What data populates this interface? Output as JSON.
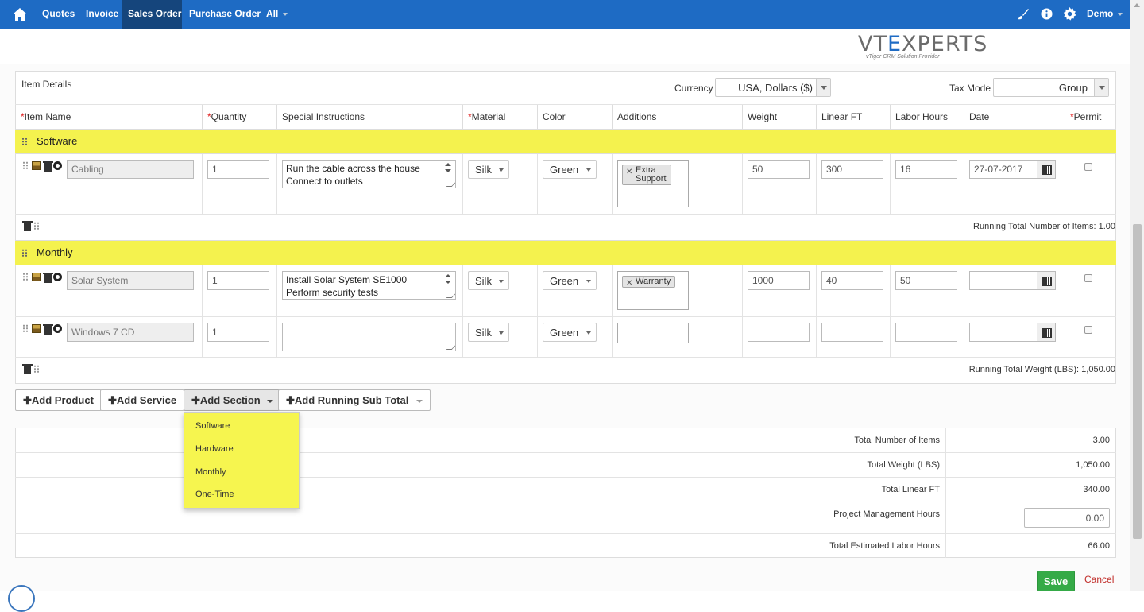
{
  "nav": {
    "items": [
      "Quotes",
      "Invoice",
      "Sales Order",
      "Purchase Order",
      "All"
    ],
    "user": "Demo"
  },
  "logo": {
    "text_pre": "VT",
    "text_x": "E",
    "text_post": "XPERTS",
    "tagline": "vTiger CRM Solution Provider"
  },
  "item_details": {
    "title": "Item Details",
    "currency_label": "Currency",
    "currency_value": "USA, Dollars ($)",
    "tax_mode_label": "Tax Mode",
    "tax_mode_value": "Group"
  },
  "columns": [
    "Item Name",
    "Quantity",
    "Special Instructions",
    "Material",
    "Color",
    "Additions",
    "Weight",
    "Linear FT",
    "Labor Hours",
    "Date",
    "Permit"
  ],
  "required_mark": "*",
  "sections": [
    {
      "name": "Software",
      "rows": [
        {
          "item": "Cabling",
          "qty": "1",
          "instr1": "Run the cable across the house",
          "instr2": "Connect to outlets",
          "material": "Silk",
          "color": "Green",
          "addition1": "Extra",
          "addition2": "Support",
          "weight": "50",
          "linear": "300",
          "labor": "16",
          "date": "27-07-2017"
        }
      ],
      "running_total": "Running Total Number of Items: 1.00"
    },
    {
      "name": "Monthly",
      "rows": [
        {
          "item": "Solar System",
          "qty": "1",
          "instr1": "Install Solar System SE1000",
          "instr2": "Perform security tests",
          "material": "Silk",
          "color": "Green",
          "addition1": "Warranty",
          "weight": "1000",
          "linear": "40",
          "labor": "50",
          "date": ""
        },
        {
          "item": "Windows 7 CD",
          "qty": "1",
          "instr1": "",
          "instr2": "",
          "material": "Silk",
          "color": "Green",
          "weight": "",
          "linear": "",
          "labor": "",
          "date": ""
        }
      ],
      "running_total": "Running Total Weight (LBS): 1,050.00"
    }
  ],
  "buttons": {
    "add_product": "Add Product",
    "add_service": "Add Service",
    "add_section": "Add Section",
    "add_running": "Add Running Sub Total"
  },
  "section_menu": [
    "Software",
    "Hardware",
    "Monthly",
    "One-Time"
  ],
  "totals": [
    {
      "label": "Total Number of Items",
      "value": "3.00"
    },
    {
      "label": "Total Weight (LBS)",
      "value": "1,050.00"
    },
    {
      "label": "Total Linear FT",
      "value": "340.00"
    },
    {
      "label": "Project Management Hours",
      "value": "0.00"
    },
    {
      "label": "Total Estimated Labor Hours",
      "value": "66.00"
    }
  ],
  "actions": {
    "save": "Save",
    "cancel": "Cancel"
  },
  "colors": {
    "nav": "#1e6bc4",
    "nav_active": "#15457c",
    "section_band": "#f4f24e",
    "save": "#35aa47"
  }
}
